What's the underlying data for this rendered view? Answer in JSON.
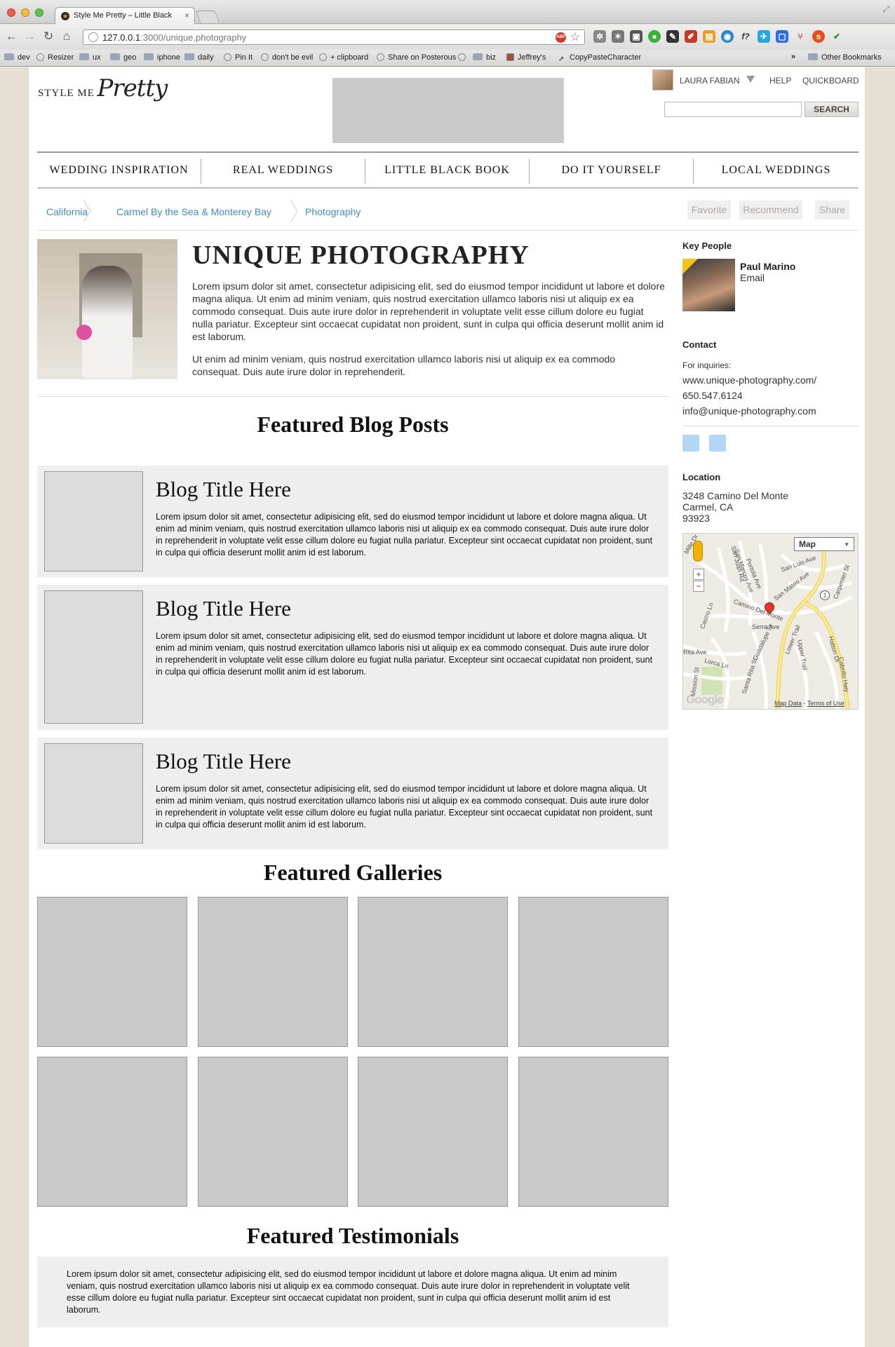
{
  "browser": {
    "tab_title": "Style Me Pretty – Little Black",
    "url_host": "127.0.0.1",
    "url_path": ":3000/unique.photography",
    "adblock_label": "ABP",
    "bookmarks": [
      {
        "label": "dev",
        "icon": "folder"
      },
      {
        "label": "Resizer",
        "icon": "globe"
      },
      {
        "label": "ux",
        "icon": "folder"
      },
      {
        "label": "geo",
        "icon": "folder"
      },
      {
        "label": "iphone",
        "icon": "folder"
      },
      {
        "label": "daily",
        "icon": "folder"
      },
      {
        "label": "Pin It",
        "icon": "globe"
      },
      {
        "label": "don't be evil",
        "icon": "globe"
      },
      {
        "label": "+ clipboard",
        "icon": "globe"
      },
      {
        "label": "Share on Posterous",
        "icon": "globe"
      },
      {
        "label": "",
        "icon": "globe"
      },
      {
        "label": "biz",
        "icon": "folder"
      },
      {
        "label": "Jeffrey's",
        "icon": "avatar"
      },
      {
        "label": "CopyPasteCharacter",
        "icon": "bookmark"
      }
    ],
    "more_bookmarks": "»",
    "other_bookmarks": "Other Bookmarks"
  },
  "site": {
    "logo_style": "STYLE ME",
    "logo_pretty": "Pretty",
    "user_name": "LAURA FABIAN",
    "help_label": "HELP",
    "quickboard_label": "QUICKBOARD",
    "search_button": "SEARCH",
    "search_placeholder": ""
  },
  "nav": [
    "WEDDING INSPIRATION",
    "REAL WEDDINGS",
    "LITTLE BLACK BOOK",
    "DO IT YOURSELF",
    "LOCAL WEDDINGS"
  ],
  "breadcrumb": [
    "California",
    "Carmel By the Sea & Monterey Bay",
    "Photography"
  ],
  "actions": {
    "favorite": "Favorite",
    "recommend": "Recommend",
    "share": "Share"
  },
  "business": {
    "title": "UNIQUE PHOTOGRAPHY",
    "description_1": "Lorem ipsum dolor sit amet, consectetur adipisicing elit, sed do eiusmod tempor incididunt ut labore et dolore magna aliqua. Ut enim ad minim veniam, quis nostrud exercitation ullamco laboris nisi ut aliquip ex ea commodo consequat. Duis aute irure dolor in reprehenderit in voluptate velit esse cillum dolore eu fugiat nulla pariatur. Excepteur sint occaecat cupidatat non proident, sunt in culpa qui officia deserunt mollit anim id est laborum.",
    "description_2": "Ut enim ad minim veniam, quis nostrud exercitation ullamco laboris nisi ut aliquip ex ea commodo consequat. Duis aute irure dolor in reprehenderit."
  },
  "featured_blog": {
    "heading": "Featured Blog Posts",
    "posts": [
      {
        "title": "Blog Title Here",
        "excerpt": "Lorem ipsum dolor sit amet, consectetur adipisicing elit, sed do eiusmod tempor incididunt ut labore et dolore magna aliqua. Ut enim ad minim veniam, quis nostrud exercitation ullamco laboris nisi ut aliquip ex ea commodo consequat. Duis aute irure dolor in reprehenderit in voluptate velit esse cillum dolore eu fugiat nulla pariatur. Excepteur sint occaecat cupidatat non proident, sunt in culpa qui officia deserunt mollit anim id est laborum."
      },
      {
        "title": "Blog Title Here",
        "excerpt": "Lorem ipsum dolor sit amet, consectetur adipisicing elit, sed do eiusmod tempor incididunt ut labore et dolore magna aliqua. Ut enim ad minim veniam, quis nostrud exercitation ullamco laboris nisi ut aliquip ex ea commodo consequat. Duis aute irure dolor in reprehenderit in voluptate velit esse cillum dolore eu fugiat nulla pariatur. Excepteur sint occaecat cupidatat non proident, sunt in culpa qui officia deserunt mollit anim id est laborum."
      },
      {
        "title": "Blog Title Here",
        "excerpt": "Lorem ipsum dolor sit amet, consectetur adipisicing elit, sed do eiusmod tempor incididunt ut labore et dolore magna aliqua. Ut enim ad minim veniam, quis nostrud exercitation ullamco laboris nisi ut aliquip ex ea commodo consequat. Duis aute irure dolor in reprehenderit in voluptate velit esse cillum dolore eu fugiat nulla pariatur. Excepteur sint occaecat cupidatat non proident, sunt in culpa qui officia deserunt mollit anim id est laborum."
      }
    ]
  },
  "featured_galleries": {
    "heading": "Featured Galleries"
  },
  "featured_testimonials": {
    "heading": "Featured Testimonials",
    "text": "Lorem ipsum dolor sit amet, consectetur adipisicing elit, sed do eiusmod tempor incididunt ut labore et dolore magna aliqua. Ut enim ad minim veniam, quis nostrud exercitation ullamco laboris nisi ut aliquip ex ea commodo consequat. Duis aute irure dolor in reprehenderit in voluptate velit esse cillum dolore eu fugiat nulla pariatur. Excepteur sint occaecat cupidatat non proident, sunt in culpa qui officia deserunt mollit anim id est laborum."
  },
  "sidebar": {
    "key_people_heading": "Key People",
    "person_name": "Paul Marino",
    "person_email": "Email",
    "contact_heading": "Contact",
    "inquiries_label": "For inquiries:",
    "website": "www.unique-photography.com/",
    "phone": "650.547.6124",
    "email": "info@unique-photography.com",
    "location_heading": "Location",
    "address_line1": "3248 Camino Del Monte",
    "address_line2": "Carmel, CA",
    "address_line3": "93923",
    "map": {
      "type_label": "Map",
      "zoom_in": "+",
      "zoom_out": "−",
      "google": "Google",
      "map_data": "Map Data",
      "terms": "Terms of Use",
      "streets": [
        "San Juan Rd",
        "San Marcos Ave",
        "Portola Ave",
        "San Luis Ave",
        "Carpenter St",
        "San Mateo Ave",
        "Camino Del Monte",
        "Serra Ave",
        "Castro Ln",
        "Guadalupe St",
        "Lower Trail",
        "Upper Trail",
        "Hatton Dr",
        "Rita Ave",
        "Lorca Ln",
        "Santa Rita St",
        "Mission St",
        "Cabrillo Hwy",
        "Mille Dr"
      ],
      "route_number": "1"
    }
  },
  "colors": {
    "link": "#3e8dbd",
    "placeholder_gray": "#cacaca",
    "panel_gray": "#eeeeee",
    "page_background": "#e6e0d2",
    "social_blue": "#b4d6f5"
  }
}
